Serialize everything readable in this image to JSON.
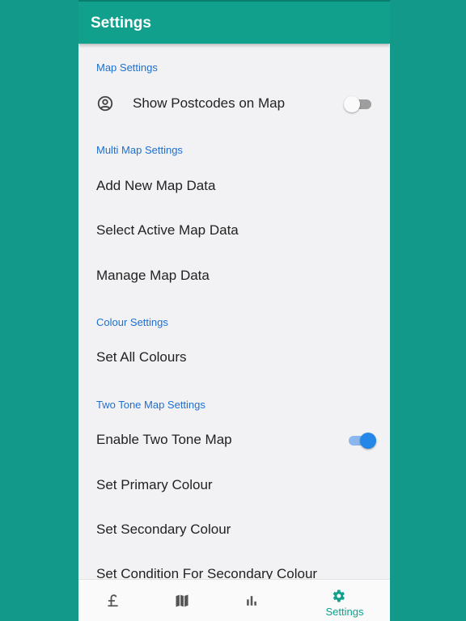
{
  "app_bar": {
    "title": "Settings"
  },
  "sections": [
    {
      "header": "Map Settings",
      "items": [
        {
          "label": "Show Postcodes on Map",
          "icon": "account-circle-icon",
          "toggle": false
        }
      ]
    },
    {
      "header": "Multi Map Settings",
      "items": [
        {
          "label": "Add New Map Data"
        },
        {
          "label": "Select Active Map Data"
        },
        {
          "label": "Manage Map Data"
        }
      ]
    },
    {
      "header": "Colour Settings",
      "items": [
        {
          "label": "Set All Colours"
        }
      ]
    },
    {
      "header": "Two Tone Map Settings",
      "items": [
        {
          "label": "Enable Two Tone Map",
          "toggle": true
        },
        {
          "label": "Set Primary Colour"
        },
        {
          "label": "Set Secondary Colour"
        },
        {
          "label": "Set Condition For Secondary Colour"
        }
      ]
    }
  ],
  "bottom_nav": {
    "items": [
      {
        "icon": "pound-icon"
      },
      {
        "icon": "map-icon"
      },
      {
        "icon": "bar-chart-icon"
      },
      {
        "icon": "gear-icon",
        "label": "Settings",
        "active": true
      }
    ]
  },
  "colors": {
    "background": "#12998a",
    "app_bar": "#10a08c",
    "accent": "#1e6fd0",
    "toggle_on": "#2486e6"
  }
}
